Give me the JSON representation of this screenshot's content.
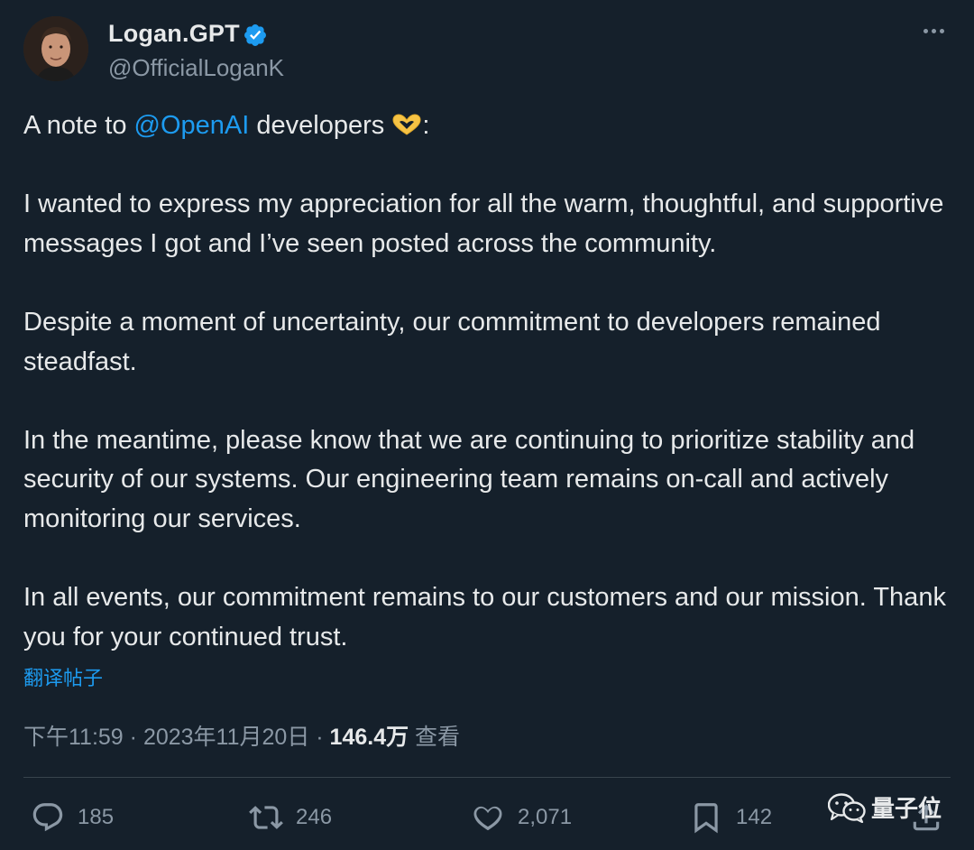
{
  "author": {
    "display_name": "Logan.GPT",
    "handle": "@OfficialLoganK",
    "verified": true
  },
  "post": {
    "line1_prefix": "A note to ",
    "line1_mention": "@OpenAI",
    "line1_suffix": " developers ",
    "line1_colon": ":",
    "paragraph2": "I wanted to express my appreciation for all the warm, thoughtful, and supportive messages I got and I’ve seen posted across the community.",
    "paragraph3": "Despite a moment of uncertainty, our commitment to developers remained steadfast.",
    "paragraph4": "In the meantime, please know that we are continuing to prioritize stability and security of our systems. Our engineering team remains on-call and actively monitoring our services.",
    "paragraph5": "In all events, our commitment remains to our customers and our mission. Thank you for your continued trust."
  },
  "translate_label": "翻译帖子",
  "meta": {
    "time": "下午11:59",
    "sep": " · ",
    "date": "2023年11月20日",
    "views_count": "146.4万",
    "views_label": " 查看"
  },
  "actions": {
    "replies": "185",
    "reposts": "246",
    "likes": "2,071",
    "bookmarks": "142"
  },
  "watermark": "量子位",
  "colors": {
    "background": "#15202b",
    "accent": "#1d9bf0",
    "muted": "#8b98a5"
  }
}
